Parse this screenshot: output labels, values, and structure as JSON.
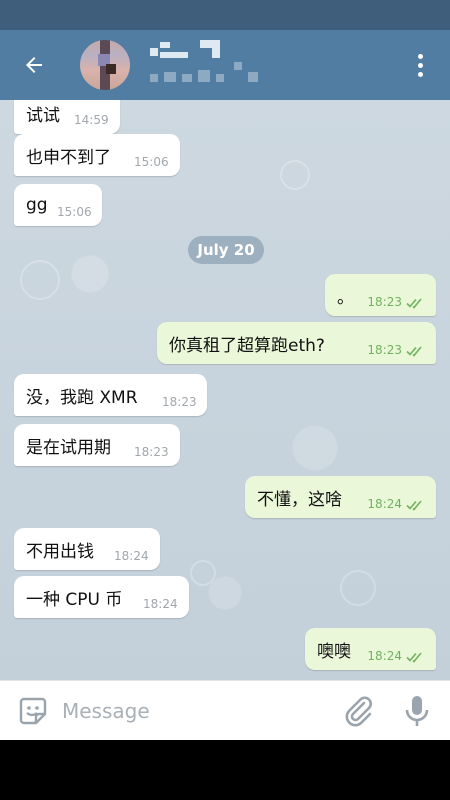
{
  "colors": {
    "status_bar": "#3f5e7c",
    "app_bar": "#527da3",
    "chat_background": "#c9d5de",
    "incoming_bubble": "#ffffff",
    "outgoing_bubble": "#ebf7d9",
    "read_ticks": "#6fb35f"
  },
  "header": {
    "back_icon": "arrow-left-icon",
    "menu_icon": "more-vertical-icon"
  },
  "chat": {
    "date_separator": "July 20",
    "messages": [
      {
        "direction": "in",
        "text": "试试",
        "time": "14:59"
      },
      {
        "direction": "in",
        "text": "也申不到了",
        "time": "15:06"
      },
      {
        "direction": "in",
        "text": "gg",
        "time": "15:06"
      },
      {
        "direction": "out",
        "text": "。",
        "time": "18:23",
        "status": "read"
      },
      {
        "direction": "out",
        "text": "你真租了超算跑eth?",
        "time": "18:23",
        "status": "read"
      },
      {
        "direction": "in",
        "text": "没，我跑 XMR",
        "time": "18:23"
      },
      {
        "direction": "in",
        "text": "是在试用期",
        "time": "18:23"
      },
      {
        "direction": "out",
        "text": "不懂，这啥",
        "time": "18:24",
        "status": "read"
      },
      {
        "direction": "in",
        "text": "不用出钱",
        "time": "18:24"
      },
      {
        "direction": "in",
        "text": "一种 CPU 币",
        "time": "18:24"
      },
      {
        "direction": "out",
        "text": "噢噢",
        "time": "18:24",
        "status": "read"
      }
    ]
  },
  "composer": {
    "placeholder": "Message",
    "value": "",
    "emoji_icon": "sticker-emoji-icon",
    "attach_icon": "paperclip-icon",
    "mic_icon": "microphone-icon"
  }
}
